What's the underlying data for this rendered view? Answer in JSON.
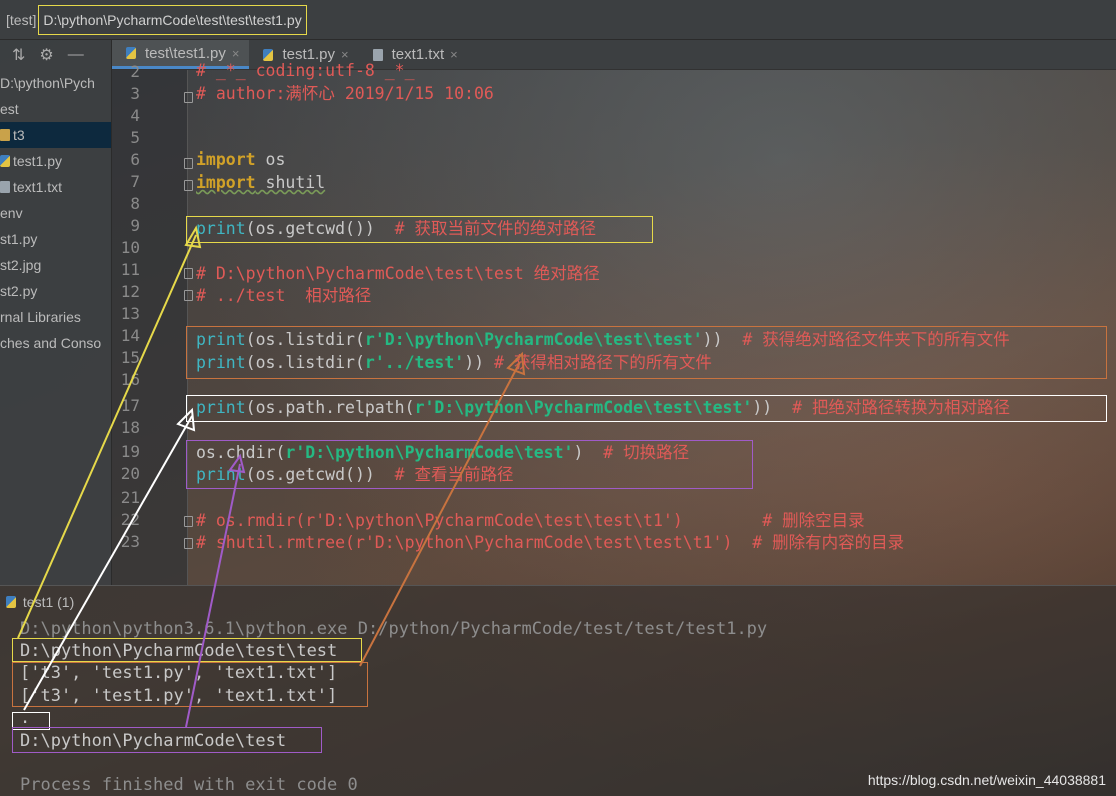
{
  "window": {
    "project_name": "[test]",
    "file_path": "D:\\python\\PycharmCode\\test\\test\\test1.py"
  },
  "project_tree": {
    "items": [
      {
        "label": "D:\\python\\Pych",
        "icon": "folder-icon"
      },
      {
        "label": "est",
        "icon": "folder-icon"
      },
      {
        "label": "t3",
        "icon": "folder-icon"
      },
      {
        "label": "test1.py",
        "icon": "python-file-icon"
      },
      {
        "label": "text1.txt",
        "icon": "text-file-icon"
      },
      {
        "label": "env",
        "icon": "folder-icon"
      },
      {
        "label": "st1.py",
        "icon": "python-file-icon"
      },
      {
        "label": "st2.jpg",
        "icon": "image-file-icon"
      },
      {
        "label": "st2.py",
        "icon": "python-file-icon"
      },
      {
        "label": "rnal Libraries",
        "icon": "library-icon"
      },
      {
        "label": "ches and Conso",
        "icon": "scratch-icon"
      }
    ]
  },
  "tabs": [
    {
      "label": "test\\test1.py",
      "close": "×"
    },
    {
      "label": "test1.py",
      "close": "×"
    },
    {
      "label": "text1.txt",
      "close": "×"
    }
  ],
  "line_numbers": [
    "2",
    "3",
    "4",
    "5",
    "6",
    "7",
    "8",
    "9",
    "10",
    "11",
    "12",
    "13",
    "14",
    "15",
    "16",
    "17",
    "18",
    "19",
    "20",
    "21",
    "22",
    "23"
  ],
  "code": {
    "l2": "# _*_ coding:utf-8 _*_",
    "l3": "# author:满怀心 2019/1/15 10:06",
    "l6_kw": "import",
    "l6_mod": " os",
    "l7_kw": "import",
    "l7_mod": " shutil",
    "l9_a": "print",
    "l9_b": "(os.getcwd())",
    "l9_c": "  # 获取当前文件的绝对路径",
    "l11": "# D:\\python\\PycharmCode\\test\\test 绝对路径",
    "l12": "# ../test  相对路径",
    "l14_a": "print",
    "l14_b": "(os.listdir(",
    "l14_s": "r'D:\\python\\PycharmCode\\test\\test'",
    "l14_c": "))",
    "l14_d": "  # 获得绝对路径文件夹下的所有文件",
    "l15_a": "print",
    "l15_b": "(os.listdir(",
    "l15_s": "r'../test'",
    "l15_c": "))",
    "l15_d": " # 获得相对路径下的所有文件",
    "l17_a": "print",
    "l17_b": "(os.path.relpath(",
    "l17_s": "r'D:\\python\\PycharmCode\\test\\test'",
    "l17_c": "))",
    "l17_d": "  # 把绝对路径转换为相对路径",
    "l19_a": "os.chdir(",
    "l19_s": "r'D:\\python\\PycharmCode\\test'",
    "l19_c": ")",
    "l19_d": "  # 切换路径",
    "l20_a": "print",
    "l20_b": "(os.getcwd())",
    "l20_c": "  # 查看当前路径",
    "l22": "# os.rmdir(r'D:\\python\\PycharmCode\\test\\test\\t1')        # 删除空目录",
    "l23": "# shutil.rmtree(r'D:\\python\\PycharmCode\\test\\test\\t1')  # 删除有内容的目录"
  },
  "run": {
    "title": "test1 (1)",
    "command": "D:\\python\\python3.6.1\\python.exe D:/python/PycharmCode/test/test/test1.py",
    "out1": "D:\\python\\PycharmCode\\test\\test",
    "out2": "['t3', 'test1.py', 'text1.txt']",
    "out3": "['t3', 'test1.py', 'text1.txt']",
    "out4": ".",
    "out5": "D:\\python\\PycharmCode\\test",
    "exit": "Process finished with exit code 0"
  },
  "watermark": "https://blog.csdn.net/weixin_44038881",
  "colors": {
    "yellow_box": "#e6d94a",
    "orange_box": "#c8733f",
    "white_box": "#ffffff",
    "purple_box": "#a05bc8",
    "comment": "#e05a57",
    "keyword": "#d1a128",
    "string": "#25b983",
    "builtin": "#3fb6c3"
  }
}
